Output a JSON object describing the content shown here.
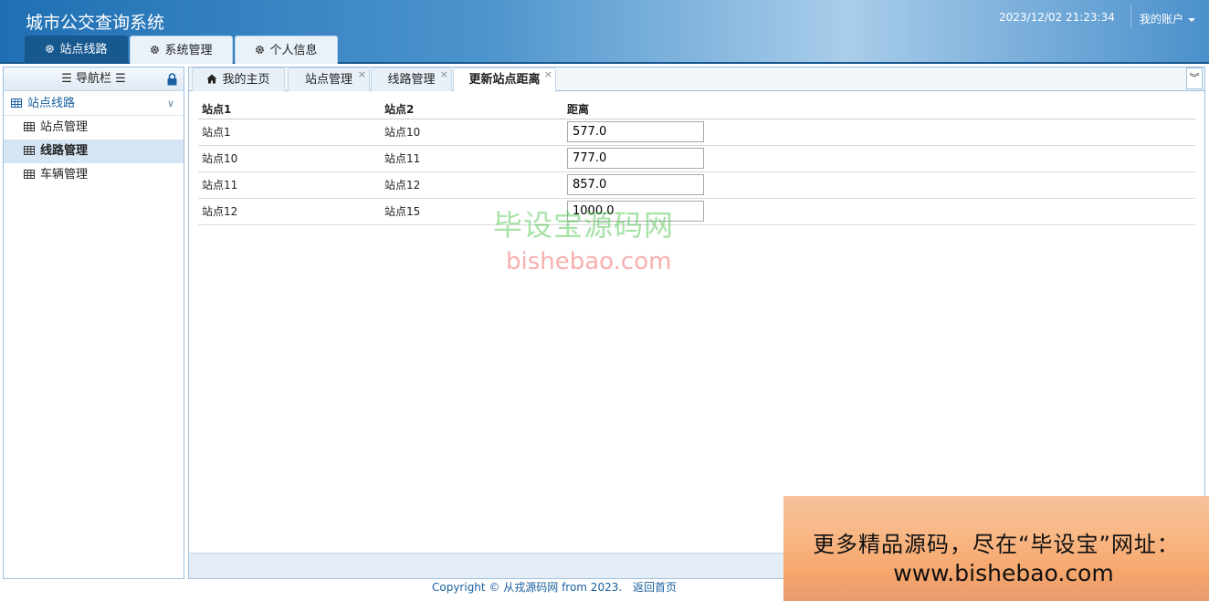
{
  "header": {
    "app_title": "城市公交查询系统",
    "datetime": "2023/12/02 21:23:34",
    "account_label": "我的账户"
  },
  "top_tabs": [
    {
      "label": "站点线路",
      "icon": "gear-icon",
      "active": true
    },
    {
      "label": "系统管理",
      "icon": "gear-icon",
      "active": false
    },
    {
      "label": "个人信息",
      "icon": "gear-icon",
      "active": false
    }
  ],
  "nav": {
    "title": "导航栏",
    "group_label": "站点线路",
    "items": [
      {
        "label": "站点管理",
        "selected": false
      },
      {
        "label": "线路管理",
        "selected": true
      },
      {
        "label": "车辆管理",
        "selected": false
      }
    ]
  },
  "tabs": [
    {
      "label": "我的主页",
      "icon": "home-icon"
    },
    {
      "label": "站点管理",
      "closable": true
    },
    {
      "label": "线路管理",
      "closable": true
    },
    {
      "label": "更新站点距离",
      "closable": true,
      "active": true
    }
  ],
  "table": {
    "headers": [
      "站点1",
      "站点2",
      "距离"
    ],
    "rows": [
      {
        "station1": "站点1",
        "station2": "站点10",
        "distance": "577.0"
      },
      {
        "station1": "站点10",
        "station2": "站点11",
        "distance": "777.0"
      },
      {
        "station1": "站点11",
        "station2": "站点12",
        "distance": "857.0"
      },
      {
        "station1": "站点12",
        "station2": "站点15",
        "distance": "1000.0"
      }
    ]
  },
  "watermark": {
    "line1": "毕设宝源码网",
    "line2": "bishebao.com"
  },
  "footer": {
    "copyright": "Copyright © 从戎源码网 from 2023.",
    "home_link": "返回首页"
  },
  "banner": {
    "line1": "更多精品源码，尽在“毕设宝”网址：",
    "line2": "www.bishebao.com"
  },
  "colors": {
    "header_dark": "#17588f",
    "link_blue": "#1a5fa0",
    "panel_border": "#9ec0dd"
  }
}
